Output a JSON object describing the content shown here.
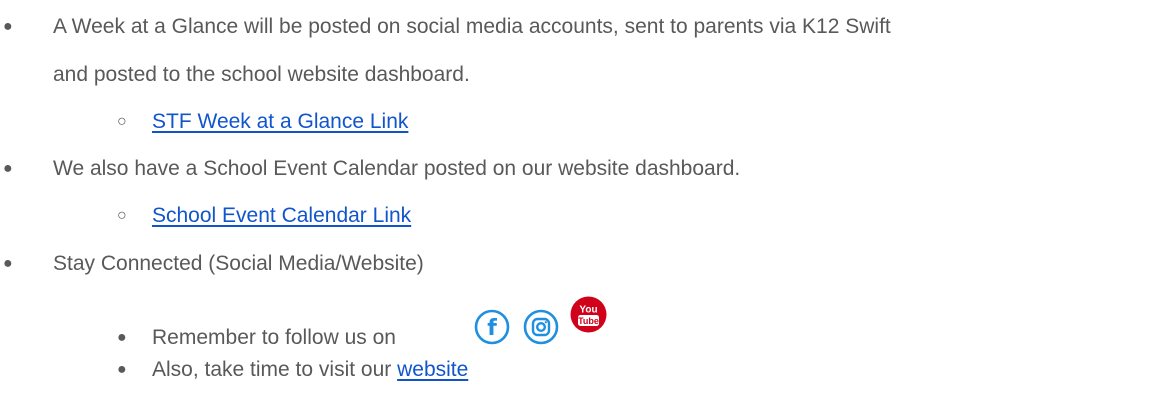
{
  "bullets": {
    "glance_text": "A Week at a Glance will be posted on social media accounts, sent to parents via K12 Swift",
    "glance_text_cont": "and posted to the school website dashboard.",
    "glance_link": "STF Week at a Glance Link",
    "calendar_text": "We also have a School Event Calendar posted on our website dashboard.",
    "calendar_link": "School Event Calendar Link",
    "connected_text": "Stay Connected (Social Media/Website)",
    "follow_text": "Remember to follow us on",
    "visit_text": "Also, take time to visit our ",
    "website_link": "website"
  },
  "markers": {
    "filled": "●",
    "hollow": "○"
  },
  "icons": {
    "facebook": "facebook-icon",
    "instagram": "instagram-icon",
    "youtube": "youtube-icon",
    "youtube_top": "You",
    "youtube_bottom": "Tube"
  },
  "colors": {
    "text": "#595959",
    "link": "#1155cc",
    "social_blue": "#1f8fe0",
    "youtube_red": "#d0021b"
  }
}
